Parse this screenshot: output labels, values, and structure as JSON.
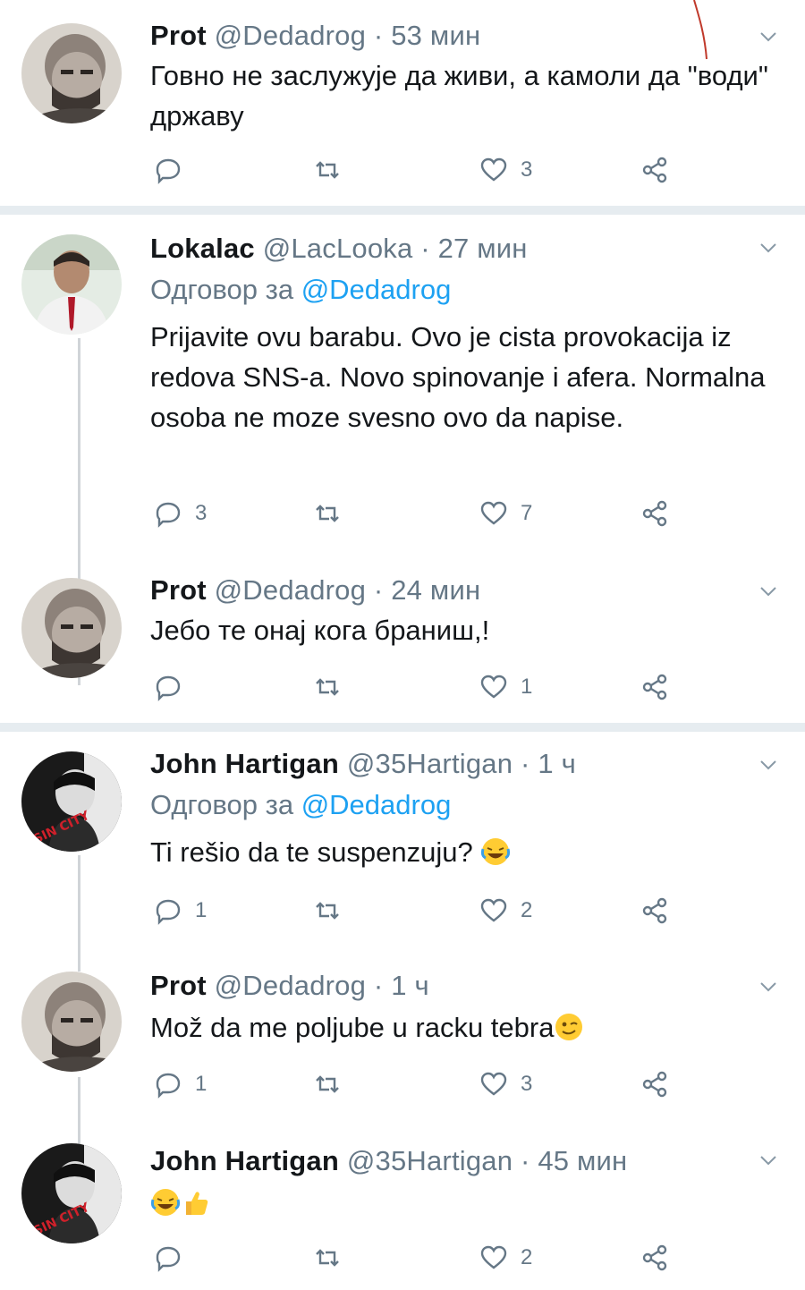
{
  "tweets": [
    {
      "name": "Prot",
      "handle": "@Dedadrog",
      "time": "· 53 мин",
      "reply_to": "",
      "text": "Говно не заслужује да живи, а камоли да \"води\" државу",
      "reply_count": "",
      "like_count": "3",
      "avatar": "bald-man",
      "colors": {
        "avatar_bg": "#cfc9c2"
      }
    },
    {
      "name": "Lokalac",
      "handle": "@LacLooka",
      "time": "· 27 мин",
      "reply_prefix": "Одговор за",
      "reply_to": "@Dedadrog",
      "text": "Prijavite ovu barabu. Ovo je cista provokacija iz redova SNS-a. Novo spinovanje i afera. Normalna osoba ne moze svesno ovo da napise.",
      "reply_count": "3",
      "like_count": "7",
      "avatar": "man-in-suit"
    },
    {
      "name": "Prot",
      "handle": "@Dedadrog",
      "time": "· 24 мин",
      "reply_to": "",
      "text": "Јебо те онај кога браниш,!",
      "reply_count": "",
      "like_count": "1",
      "avatar": "bald-man"
    },
    {
      "name": "John Hartigan",
      "handle": "@35Hartigan",
      "time": "· 1 ч",
      "reply_prefix": "Одговор за",
      "reply_to": "@Dedadrog",
      "text": "Ti rešio da te suspenzuju? ",
      "emoji": "laughing-face",
      "reply_count": "1",
      "like_count": "2",
      "avatar": "sin-city"
    },
    {
      "name": "Prot",
      "handle": "@Dedadrog",
      "time": "· 1 ч",
      "reply_to": "",
      "text": "Mož da me poljube u racku tebra",
      "emoji": "winking-face",
      "reply_count": "1",
      "like_count": "3",
      "avatar": "bald-man"
    },
    {
      "name": "John Hartigan",
      "handle": "@35Hartigan",
      "time": "· 45 мин",
      "reply_to": "",
      "text": "",
      "emoji": "laughing-face-thumbs-up",
      "reply_count": "",
      "like_count": "2",
      "avatar": "sin-city"
    }
  ],
  "icons": {
    "reply": "reply-icon",
    "retweet": "retweet-icon",
    "like": "heart-icon",
    "share": "share-icon",
    "more": "chevron-down-icon"
  },
  "colors": {
    "mention": "#1da1f2",
    "muted": "#657786",
    "divider": "#e6ecf0"
  }
}
